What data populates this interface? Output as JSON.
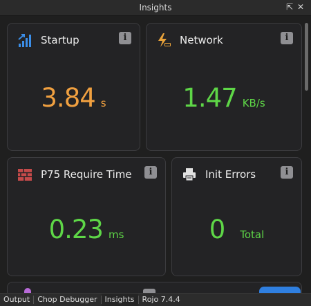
{
  "window": {
    "title": "Insights",
    "dock_icon": "undock-icon",
    "close_icon": "close-icon"
  },
  "cards": {
    "startup": {
      "label": "Startup",
      "value": "3.84",
      "unit": "s",
      "icon": "signal-bars-icon",
      "value_color": "#f0a040"
    },
    "network": {
      "label": "Network",
      "value": "1.47",
      "unit": "KB/s",
      "icon": "lightning-plug-icon",
      "value_color": "#5ed647"
    },
    "require_time": {
      "label": "P75 Require Time",
      "value": "0.23",
      "unit": "ms",
      "icon": "brick-wall-icon",
      "value_color": "#5ed647"
    },
    "init_errors": {
      "label": "Init Errors",
      "value": "0",
      "unit": "Total",
      "icon": "printer-icon",
      "value_color": "#5ed647"
    }
  },
  "info_glyph": "i",
  "tabs": [
    "Output",
    "Chop Debugger",
    "Insights",
    "Rojo 7.4.4"
  ]
}
